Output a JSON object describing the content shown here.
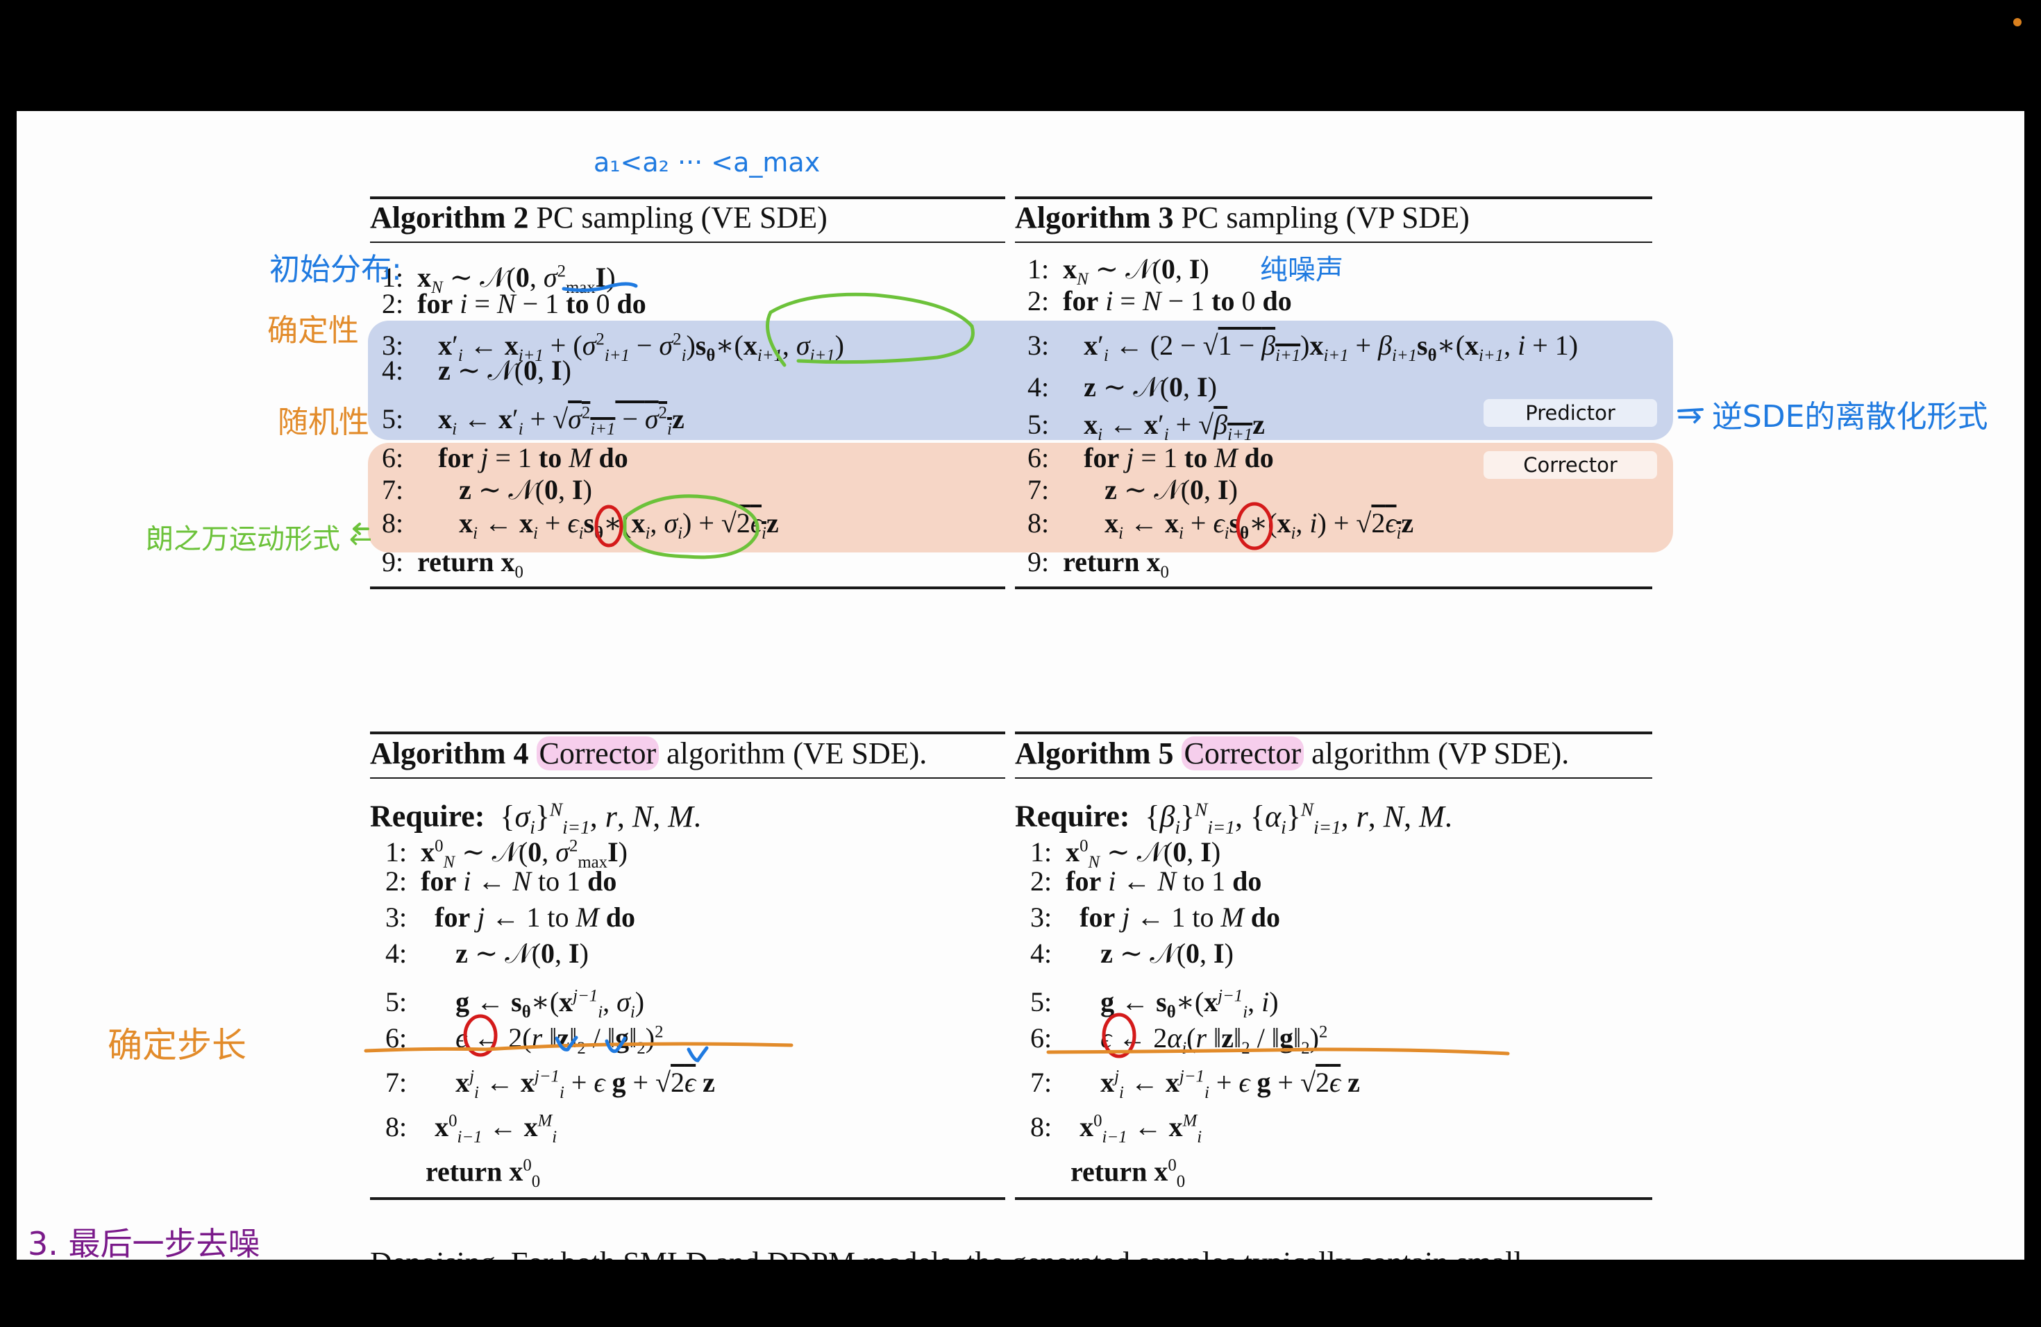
{
  "predictor_label": "Predictor",
  "corrector_label": "Corrector",
  "colors": {
    "predictor_bg": "#c9d4ec",
    "corrector_bg": "#f6d6c6",
    "ink_blue": "#1f7ae0",
    "ink_orange": "#e28b2a",
    "ink_green": "#6cc23a",
    "ink_red": "#d41a1a",
    "ink_purple": "#7a1a8a",
    "highlight_pink": "#f4b6e4"
  },
  "algo2": {
    "title_bold": "Algorithm 2",
    "title_rest": "PC sampling (VE SDE)",
    "lines": [
      {
        "num": "1:",
        "text": "x_N ~ 𝒩(0, σ²_max I)"
      },
      {
        "num": "2:",
        "text": "for i = N − 1 to 0 do"
      },
      {
        "num": "3:",
        "text": "x′_i ← x_{i+1} + (σ²_{i+1} − σ²_i) s_θ*(x_{i+1}, σ_{i+1})"
      },
      {
        "num": "4:",
        "text": "z ~ 𝒩(0, I)"
      },
      {
        "num": "5:",
        "text": "x_i ← x′_i + √(σ²_{i+1} − σ²_i) z"
      },
      {
        "num": "6:",
        "text": "for j = 1 to M do"
      },
      {
        "num": "7:",
        "text": "z ~ 𝒩(0, I)"
      },
      {
        "num": "8:",
        "text": "x_i ← x_i + ε_i s_θ*(x_i, σ_i) + √(2ε_i) z"
      },
      {
        "num": "9:",
        "text": "return x_0"
      }
    ]
  },
  "algo3": {
    "title_bold": "Algorithm 3",
    "title_rest": "PC sampling (VP SDE)",
    "lines": [
      {
        "num": "1:",
        "text": "x_N ~ 𝒩(0, I)"
      },
      {
        "num": "2:",
        "text": "for i = N − 1 to 0 do"
      },
      {
        "num": "3:",
        "text": "x′_i ← (2 − √(1 − β_{i+1})) x_{i+1} + β_{i+1} s_θ*(x_{i+1}, i + 1)"
      },
      {
        "num": "4:",
        "text": "z ~ 𝒩(0, I)"
      },
      {
        "num": "5:",
        "text": "x_i ← x′_i + √β_{i+1} z"
      },
      {
        "num": "6:",
        "text": "for j = 1 to M do"
      },
      {
        "num": "7:",
        "text": "z ~ 𝒩(0, I)"
      },
      {
        "num": "8:",
        "text": "x_i ← x_i + ε_i s_θ*(x_i, i) + √(2ε_i) z"
      },
      {
        "num": "9:",
        "text": "return x_0"
      }
    ]
  },
  "algo4": {
    "title_bold": "Algorithm 4",
    "title_highlight": "Corrector",
    "title_rest": "algorithm (VE SDE).",
    "require_label": "Require:",
    "require_text": "{σ_i}^N_{i=1}, r, N, M.",
    "lines": [
      {
        "num": "1:",
        "text": "x⁰_N ~ 𝒩(0, σ²_max I)"
      },
      {
        "num": "2:",
        "text": "for i ← N to 1 do"
      },
      {
        "num": "3:",
        "text": "for j ← 1 to M do"
      },
      {
        "num": "4:",
        "text": "z ~ 𝒩(0, I)"
      },
      {
        "num": "5:",
        "text": "g ← s_θ*(x^{j−1}_i, σ_i)"
      },
      {
        "num": "6:",
        "text": "ε ← 2(r ‖z‖₂ / ‖g‖₂)²"
      },
      {
        "num": "7:",
        "text": "x^j_i ← x^{j−1}_i + ε g + √(2ε) z"
      },
      {
        "num": "8:",
        "text": "x⁰_{i−1} ← x^M_i"
      },
      {
        "num": "",
        "text": "return x⁰_0"
      }
    ]
  },
  "algo5": {
    "title_bold": "Algorithm 5",
    "title_highlight": "Corrector",
    "title_rest": "algorithm (VP SDE).",
    "require_label": "Require:",
    "require_text": "{β_i}^N_{i=1}, {α_i}^N_{i=1}, r, N, M.",
    "lines": [
      {
        "num": "1:",
        "text": "x⁰_N ~ 𝒩(0, I)"
      },
      {
        "num": "2:",
        "text": "for i ← N to 1 do"
      },
      {
        "num": "3:",
        "text": "for j ← 1 to M do"
      },
      {
        "num": "4:",
        "text": "z ~ 𝒩(0, I)"
      },
      {
        "num": "5:",
        "text": "g ← s_θ*(x^{j−1}_i, i)"
      },
      {
        "num": "6:",
        "text": "ε ← 2α_i(r ‖z‖₂ / ‖g‖₂)²"
      },
      {
        "num": "7:",
        "text": "x^j_i ← x^{j−1}_i + ε g + √(2ε) z"
      },
      {
        "num": "8:",
        "text": "x⁰_{i−1} ← x^M_i"
      },
      {
        "num": "",
        "text": "return x⁰_0"
      }
    ]
  },
  "annotations": {
    "top_sequence": "a₁<a₂ ··· <a_max",
    "initial_distribution": "初始分布:",
    "deterministic": "确定性",
    "randomness": "随机性",
    "pure_noise": "纯噪声",
    "reverse_sde_discrete": "→ 逆SDE的离散化形式",
    "langevin_form": "朗之万运动形式 ←",
    "determine_step": "确定步长",
    "final_step": "3. 最后一步去噪"
  },
  "footer_clipped_text": "Denoising. For both SMLD and DDPM models, the generated samples typically contain small"
}
